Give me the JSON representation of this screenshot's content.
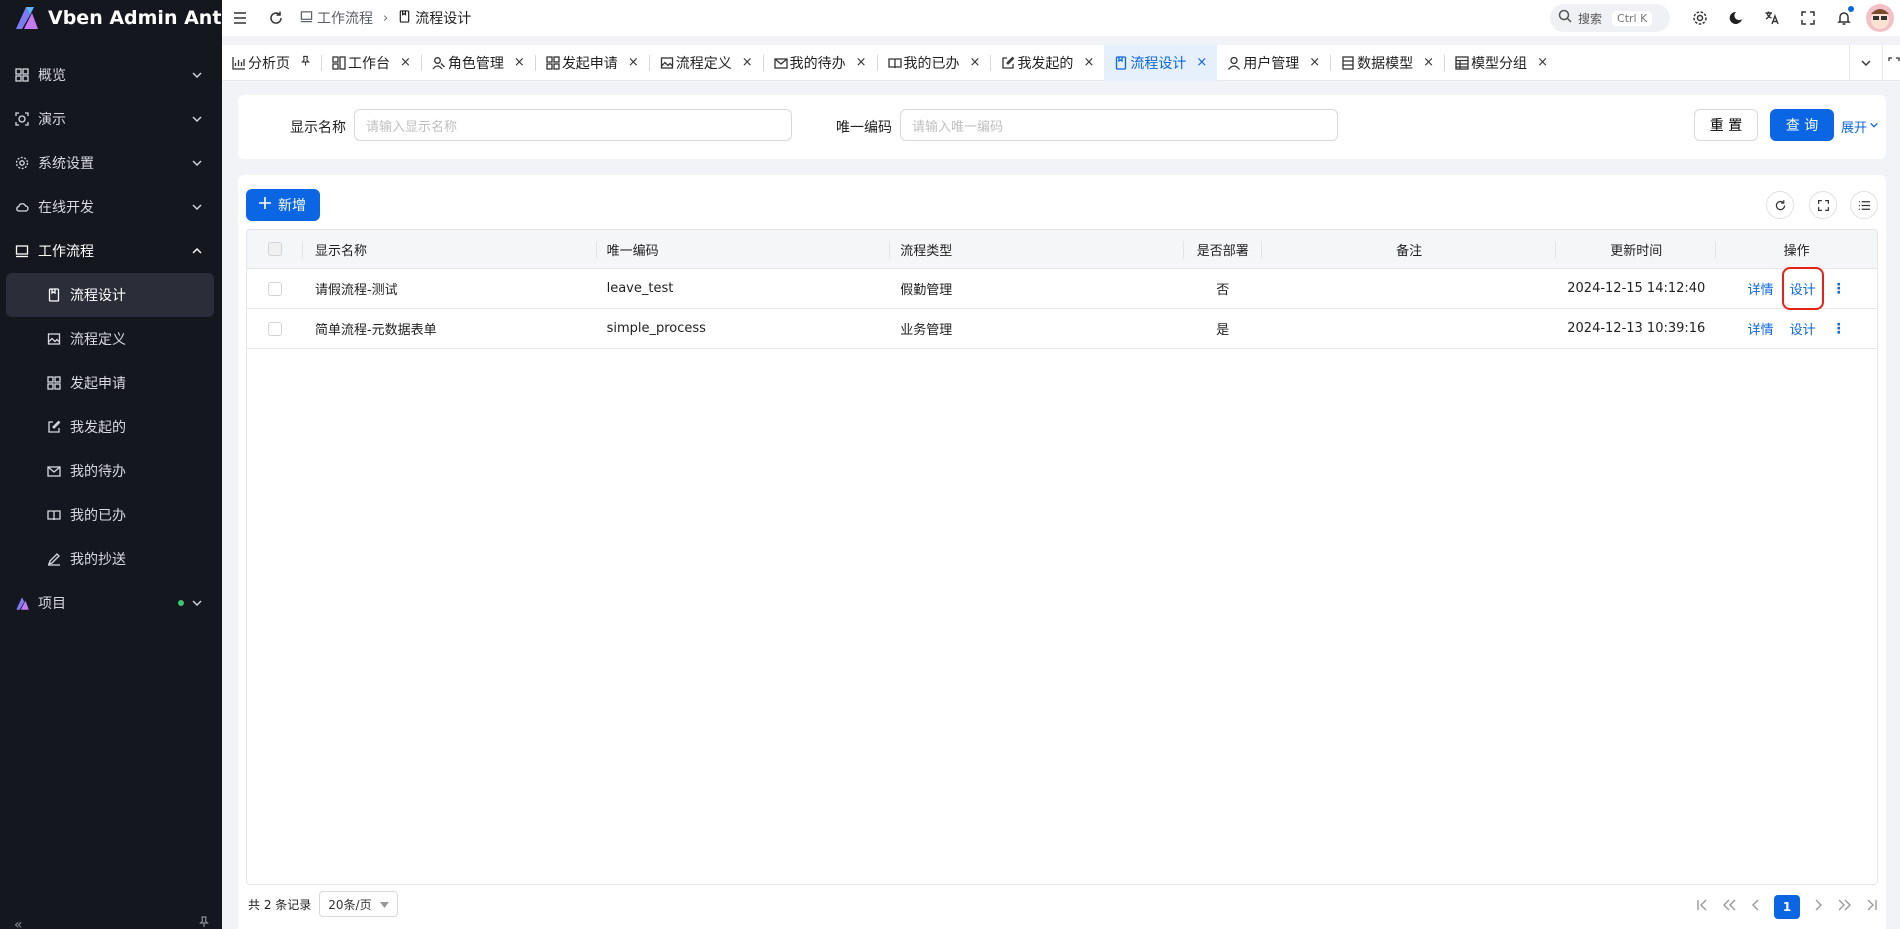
{
  "app": {
    "brand": "Vben Admin Antd"
  },
  "sidebar": {
    "items": [
      {
        "label": "概览",
        "icon": "grid-icon"
      },
      {
        "label": "演示",
        "icon": "demo-icon"
      },
      {
        "label": "系统设置",
        "icon": "gear-icon"
      },
      {
        "label": "在线开发",
        "icon": "cloud-icon"
      },
      {
        "label": "工作流程",
        "icon": "monitor-icon"
      }
    ],
    "workflow_sub": [
      {
        "label": "流程设计",
        "icon": "document-icon"
      },
      {
        "label": "流程定义",
        "icon": "image-icon"
      },
      {
        "label": "发起申请",
        "icon": "grid-icon"
      },
      {
        "label": "我发起的",
        "icon": "edit-icon"
      },
      {
        "label": "我的待办",
        "icon": "mail-icon"
      },
      {
        "label": "我的已办",
        "icon": "book-icon"
      },
      {
        "label": "我的抄送",
        "icon": "pen-icon"
      }
    ],
    "project": {
      "label": "项目",
      "icon": "logo-icon"
    }
  },
  "header": {
    "breadcrumb": [
      {
        "label": "工作流程"
      },
      {
        "label": "流程设计"
      }
    ],
    "search_label": "搜索",
    "search_kbd": "Ctrl K"
  },
  "tabs": [
    {
      "label": "分析页",
      "icon": "chart-icon",
      "close": "pin"
    },
    {
      "label": "工作台",
      "icon": "workbench-icon"
    },
    {
      "label": "角色管理",
      "icon": "users-icon"
    },
    {
      "label": "发起申请",
      "icon": "grid-icon"
    },
    {
      "label": "流程定义",
      "icon": "image-icon"
    },
    {
      "label": "我的待办",
      "icon": "mail-icon"
    },
    {
      "label": "我的已办",
      "icon": "book-icon"
    },
    {
      "label": "我发起的",
      "icon": "edit-icon"
    },
    {
      "label": "流程设计",
      "icon": "document-icon"
    },
    {
      "label": "用户管理",
      "icon": "user-icon"
    },
    {
      "label": "数据模型",
      "icon": "database-icon"
    },
    {
      "label": "模型分组",
      "icon": "table-icon"
    }
  ],
  "tab_close_glyph": "×",
  "filters": {
    "display_name_label": "显示名称",
    "display_name_placeholder": "请输入显示名称",
    "unique_code_label": "唯一编码",
    "unique_code_placeholder": "请输入唯一编码",
    "reset_label": "重 置",
    "query_label": "查 询",
    "expand_label": "展开"
  },
  "table": {
    "add_label": "新增",
    "columns": [
      "显示名称",
      "唯一编码",
      "流程类型",
      "是否部署",
      "备注",
      "更新时间",
      "操作"
    ],
    "rows": [
      {
        "name": "请假流程-测试",
        "key": "leave_test",
        "type": "假勤管理",
        "deployed": "否",
        "remark": "",
        "updated": "2024-12-15 14:12:40",
        "op_detail": "详情",
        "op_design": "设计"
      },
      {
        "name": "简单流程-元数据表单",
        "key": "simple_process",
        "type": "业务管理",
        "deployed": "是",
        "remark": "",
        "updated": "2024-12-13 10:39:16",
        "op_detail": "详情",
        "op_design": "设计"
      }
    ]
  },
  "pagination": {
    "total_text": "共 2 条记录",
    "page_size": "20条/页",
    "current_page": "1"
  },
  "colors": {
    "primary": "#0b66e4",
    "sidebar_bg": "#15171f",
    "highlight": "#e2231a"
  }
}
